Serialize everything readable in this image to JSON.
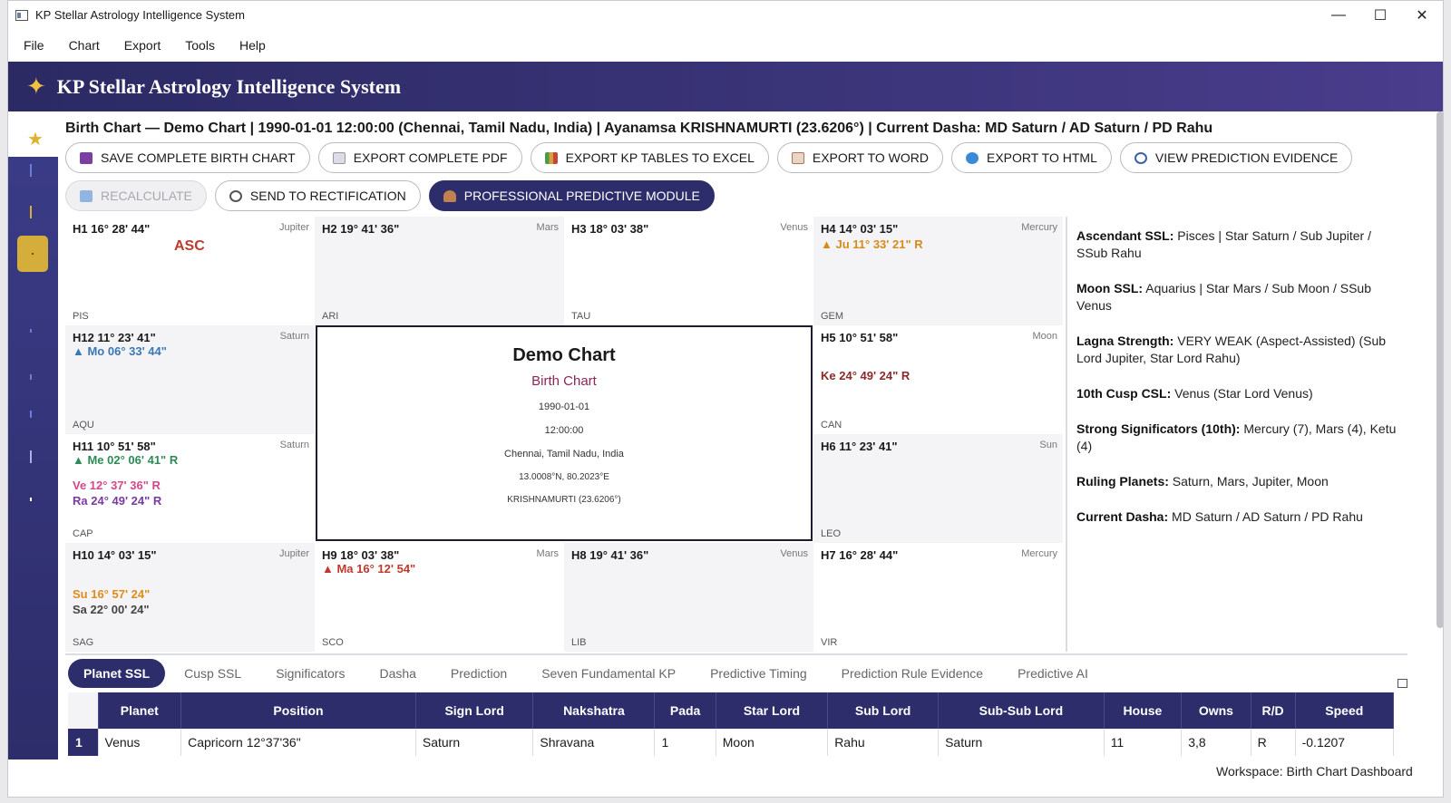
{
  "window": {
    "title": "KP Stellar Astrology Intelligence System"
  },
  "menu": [
    "File",
    "Chart",
    "Export",
    "Tools",
    "Help"
  ],
  "banner": {
    "title": "KP Stellar Astrology Intelligence System"
  },
  "info_line": "Birth Chart — Demo Chart  |  1990-01-01 12:00:00 (Chennai, Tamil Nadu, India)  |  Ayanamsa KRISHNAMURTI (23.6206°)  |  Current Dasha: MD Saturn / AD Saturn / PD Rahu",
  "buttons_row1": [
    {
      "label": "SAVE COMPLETE BIRTH CHART",
      "color": "#7a3fa0"
    },
    {
      "label": "EXPORT COMPLETE PDF",
      "color": "#c9c9d6"
    },
    {
      "label": "EXPORT KP TABLES TO EXCEL",
      "color": "#4a9a4e"
    },
    {
      "label": "EXPORT TO WORD",
      "color": "#b4714a"
    },
    {
      "label": "EXPORT TO HTML",
      "color": "#3a8ad6"
    },
    {
      "label": "VIEW PREDICTION EVIDENCE",
      "color": "#3b62a8"
    }
  ],
  "buttons_row2": [
    {
      "label": "RECALCULATE",
      "color": "#8fb5e0"
    },
    {
      "label": "SEND TO RECTIFICATION",
      "color": "#555"
    },
    {
      "label": "PROFESSIONAL PREDICTIVE MODULE",
      "color": "#c08050"
    }
  ],
  "houses": {
    "h1": {
      "head": "H1  16° 28' 44\"",
      "lord": "Jupiter",
      "sign": "PIS",
      "asc": "ASC"
    },
    "h2": {
      "head": "H2  19° 41' 36\"",
      "lord": "Mars",
      "sign": "ARI"
    },
    "h3": {
      "head": "H3  18° 03' 38\"",
      "lord": "Venus",
      "sign": "TAU"
    },
    "h4": {
      "head": "H4  14° 03' 15\"",
      "lord": "Mercury",
      "sign": "GEM",
      "p1": "▲ Ju 11° 33' 21\" R"
    },
    "h12": {
      "head": "H12  11° 23' 41\"",
      "lord": "Saturn",
      "sign": "AQU",
      "p1": "▲ Mo 06° 33' 44\""
    },
    "h5": {
      "head": "H5  10° 51' 58\"",
      "lord": "Moon",
      "sign": "CAN",
      "p1": "Ke 24° 49' 24\" R"
    },
    "h11": {
      "head": "H11  10° 51' 58\"",
      "lord": "Saturn",
      "sign": "CAP",
      "p1": "▲ Me 02° 06' 41\" R",
      "p2": "Ve 12° 37' 36\" R",
      "p3": "Ra 24° 49' 24\" R"
    },
    "h6": {
      "head": "H6  11° 23' 41\"",
      "lord": "Sun",
      "sign": "LEO"
    },
    "h10": {
      "head": "H10  14° 03' 15\"",
      "lord": "Jupiter",
      "sign": "SAG",
      "p1": "Su 16° 57' 24\"",
      "p2": "Sa 22° 00' 24\""
    },
    "h9": {
      "head": "H9  18° 03' 38\"",
      "lord": "Mars",
      "sign": "SCO",
      "p1": "▲ Ma 16° 12' 54\""
    },
    "h8": {
      "head": "H8  19° 41' 36\"",
      "lord": "Venus",
      "sign": "LIB"
    },
    "h7": {
      "head": "H7  16° 28' 44\"",
      "lord": "Mercury",
      "sign": "VIR"
    }
  },
  "center": {
    "title": "Demo Chart",
    "subtitle": "Birth Chart",
    "date": "1990-01-01",
    "time": "12:00:00",
    "place": "Chennai, Tamil Nadu, India",
    "coords": "13.0008°N, 80.2023°E",
    "ayanamsa": "KRISHNAMURTI (23.6206°)"
  },
  "summary": [
    {
      "k": "Ascendant SSL:",
      "v": " Pisces | Star Saturn / Sub Jupiter / SSub Rahu"
    },
    {
      "k": "Moon SSL:",
      "v": " Aquarius | Star Mars / Sub Moon / SSub Venus"
    },
    {
      "k": "Lagna Strength:",
      "v": " VERY WEAK (Aspect-Assisted) (Sub Lord Jupiter, Star Lord Rahu)"
    },
    {
      "k": "10th Cusp CSL:",
      "v": " Venus (Star Lord Venus)"
    },
    {
      "k": "Strong Significators (10th):",
      "v": " Mercury (7), Mars (4), Ketu (4)"
    },
    {
      "k": "Ruling Planets:",
      "v": " Saturn, Mars, Jupiter, Moon"
    },
    {
      "k": "Current Dasha:",
      "v": " MD Saturn / AD Saturn / PD Rahu"
    }
  ],
  "tabs": [
    "Planet SSL",
    "Cusp SSL",
    "Significators",
    "Dasha",
    "Prediction",
    "Seven Fundamental KP",
    "Predictive Timing",
    "Prediction Rule Evidence",
    "Predictive AI"
  ],
  "table": {
    "columns": [
      "Planet",
      "Position",
      "Sign Lord",
      "Nakshatra",
      "Pada",
      "Star Lord",
      "Sub Lord",
      "Sub-Sub Lord",
      "House",
      "Owns",
      "R/D",
      "Speed"
    ],
    "rows": [
      {
        "n": "1",
        "cells": [
          "Venus",
          "Capricorn 12°37'36\"",
          "Saturn",
          "Shravana",
          "1",
          "Moon",
          "Rahu",
          "Saturn",
          "11",
          "3,8",
          "R",
          "-0.1207"
        ]
      }
    ]
  },
  "status": "Workspace: Birth Chart Dashboard"
}
